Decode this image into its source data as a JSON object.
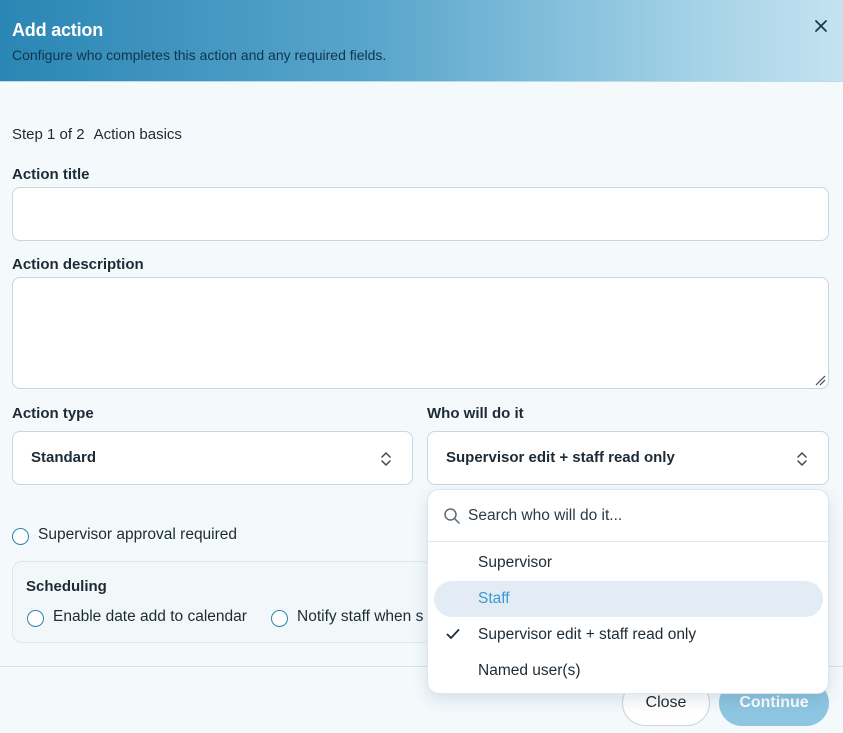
{
  "dialog": {
    "title": "Add action",
    "subtitle": "Configure who completes this action and any required fields.",
    "close_icon": "close-icon"
  },
  "step": {
    "counter": "Step 1 of 2",
    "name": "Action basics"
  },
  "form": {
    "title_label": "Action title",
    "title_value": "",
    "description_label": "Action description",
    "description_value": "",
    "type_label": "Action type",
    "type_value": "Standard",
    "assignee_label": "Who will do it",
    "assignee_value": "Supervisor edit + staff read only",
    "approval_label": "Supervisor approval required",
    "approval_checked": false
  },
  "scheduling": {
    "title": "Scheduling",
    "option1_label": "Enable date add to calendar",
    "option2_label": "Notify staff when s"
  },
  "dropdown": {
    "search_placeholder": "Search who will do it...",
    "options": [
      {
        "label": "Supervisor",
        "highlighted": false,
        "selected": false
      },
      {
        "label": "Staff",
        "highlighted": true,
        "selected": false
      },
      {
        "label": "Supervisor edit + staff read only",
        "highlighted": false,
        "selected": true
      },
      {
        "label": "Named user(s)",
        "highlighted": false,
        "selected": false
      }
    ]
  },
  "footer": {
    "close_label": "Close",
    "continue_label": "Continue"
  },
  "colors": {
    "accent": "#2a86b4",
    "highlight_bg": "#e3ebf4",
    "highlight_text": "#3a9ad0",
    "continue_bg": "#8ec6e2"
  }
}
